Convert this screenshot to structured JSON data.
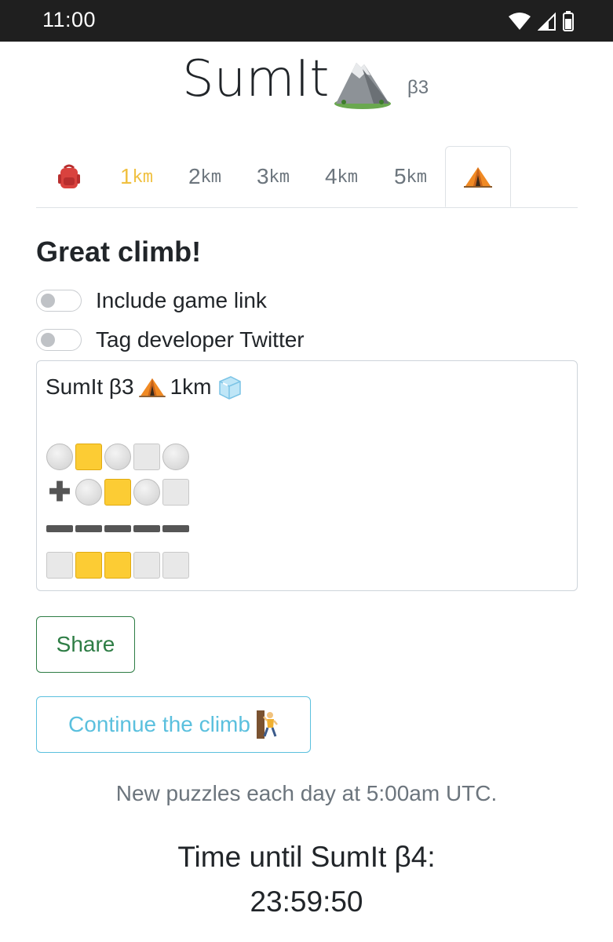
{
  "status_bar": {
    "time": "11:00"
  },
  "header": {
    "title": "SumIt",
    "version": "β3"
  },
  "tabs": [
    {
      "label": "",
      "unit": "",
      "icon": "backpack-icon"
    },
    {
      "label": "1",
      "unit": "km",
      "color": "#f0c040"
    },
    {
      "label": "2",
      "unit": "km",
      "color": "#6c757d"
    },
    {
      "label": "3",
      "unit": "km",
      "color": "#6c757d"
    },
    {
      "label": "4",
      "unit": "km",
      "color": "#6c757d"
    },
    {
      "label": "5",
      "unit": "km",
      "color": "#6c757d"
    },
    {
      "label": "",
      "unit": "",
      "icon": "tent-icon",
      "active": true
    }
  ],
  "result": {
    "heading": "Great climb!"
  },
  "toggles": [
    {
      "label": "Include game link",
      "on": false
    },
    {
      "label": "Tag developer Twitter",
      "on": false
    }
  ],
  "share_text": {
    "first_line_prefix": "SumIt β3",
    "first_line_suffix": "1km",
    "icons": [
      "tent-icon",
      "ice-cube-icon"
    ],
    "grid": [
      [
        "circle",
        "yellow",
        "circle",
        "white",
        "circle"
      ],
      [
        "plus",
        "circle",
        "yellow",
        "circle",
        "white"
      ],
      [
        "dash",
        "dash",
        "dash",
        "dash",
        "dash"
      ],
      [
        "white",
        "yellow",
        "yellow",
        "white",
        "white"
      ]
    ]
  },
  "buttons": {
    "share": "Share",
    "continue": "Continue the climb"
  },
  "footer": {
    "info": "New puzzles each day at 5:00am UTC.",
    "countdown_label": "Time until SumIt β4:",
    "countdown": "23:59:50"
  },
  "colors": {
    "share_green": "#2e7d45",
    "continue_cyan": "#5bc0de",
    "active_tab_yellow": "#f0c040"
  }
}
